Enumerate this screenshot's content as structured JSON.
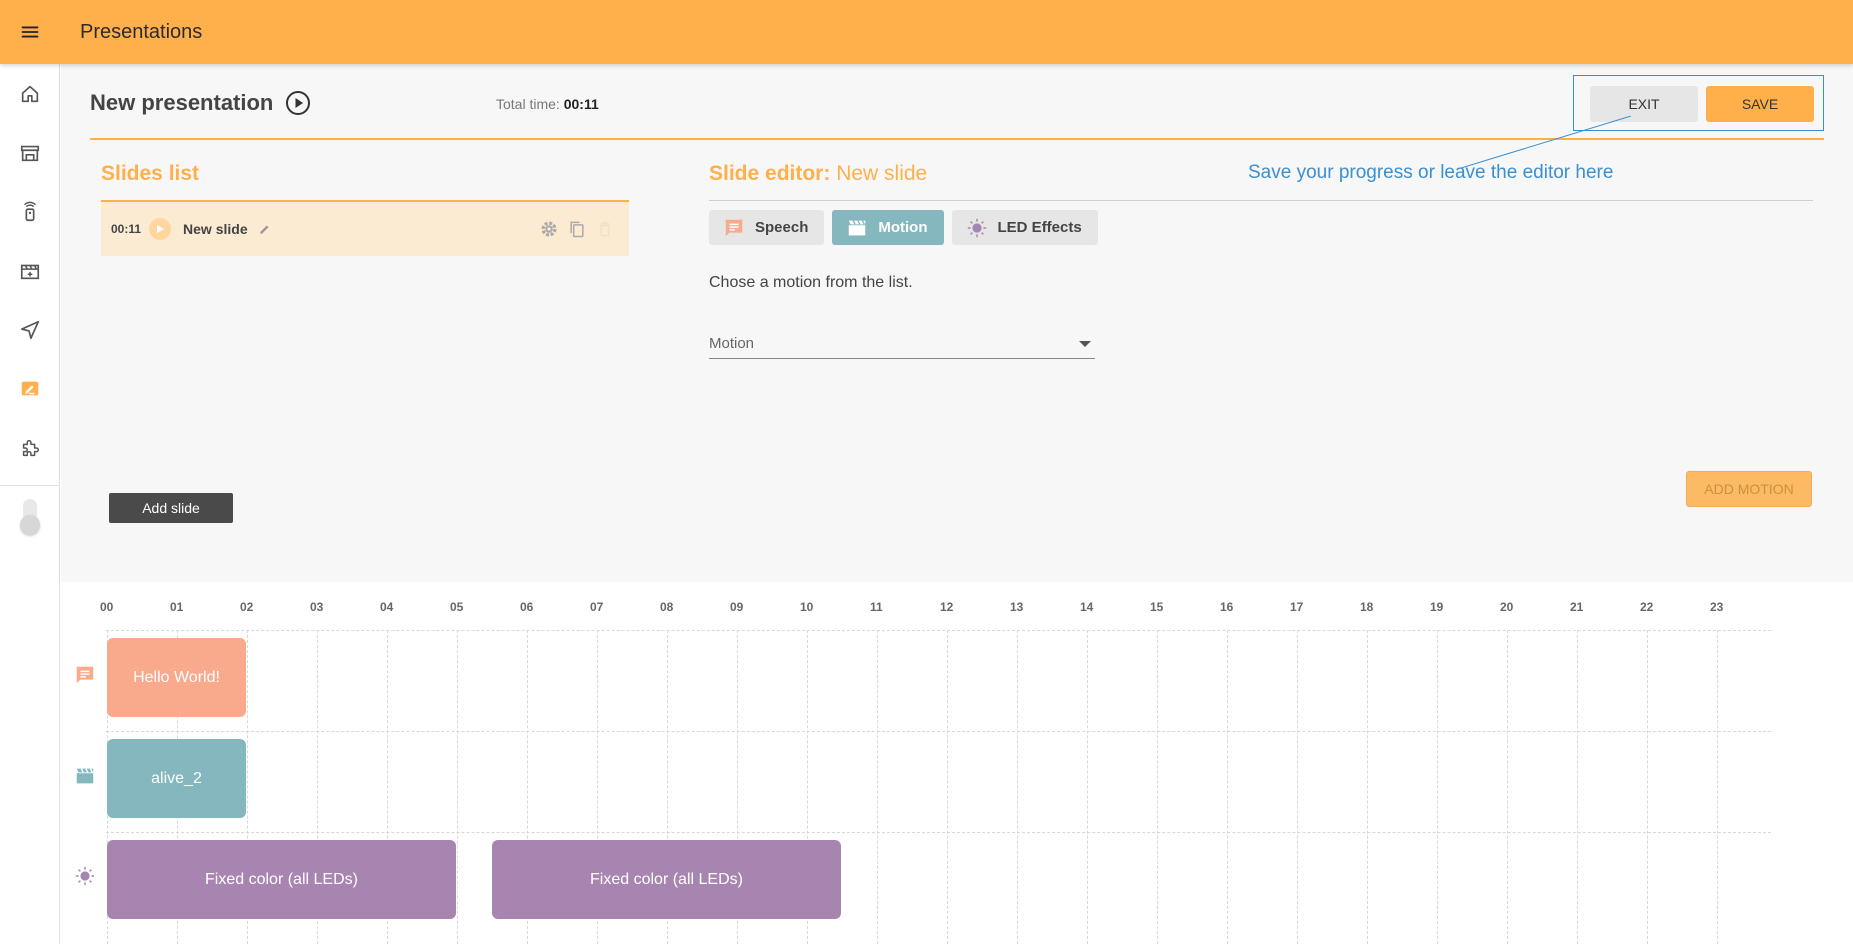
{
  "topbar": {
    "title": "Presentations"
  },
  "header": {
    "presentation_title": "New presentation",
    "total_time_label": "Total time:",
    "total_time_value": "00:11",
    "exit_label": "EXIT",
    "save_label": "SAVE",
    "callout": "Save your progress or leave the editor here"
  },
  "slides": {
    "heading": "Slides list",
    "items": [
      {
        "time": "00:11",
        "name": "New slide"
      }
    ],
    "add_label": "Add slide"
  },
  "editor": {
    "heading_label": "Slide editor:",
    "heading_name": "New slide",
    "tabs": [
      {
        "label": "Speech",
        "icon": "speech-icon"
      },
      {
        "label": "Motion",
        "icon": "motion-icon",
        "active": true
      },
      {
        "label": "LED Effects",
        "icon": "led-icon"
      }
    ],
    "instruction": "Chose a motion from the list.",
    "motion_select": {
      "value": "Motion"
    },
    "add_motion_label": "ADD MOTION"
  },
  "timeline": {
    "ticks": [
      "00",
      "01",
      "02",
      "03",
      "04",
      "05",
      "06",
      "07",
      "08",
      "09",
      "10",
      "11",
      "12",
      "13",
      "14",
      "15",
      "16",
      "17",
      "18",
      "19",
      "20",
      "21",
      "22",
      "23"
    ],
    "speech": [
      {
        "label": "Hello World!",
        "start": 0,
        "end": 2
      }
    ],
    "motion": [
      {
        "label": "alive_2",
        "start": 0,
        "end": 2
      }
    ],
    "led": [
      {
        "label": "Fixed color (all LEDs)",
        "start": 0,
        "end": 5
      },
      {
        "label": "Fixed color (all LEDs)",
        "start": 5.5,
        "end": 10.5
      }
    ]
  },
  "colors": {
    "accent": "#ffb04b",
    "speech": "#f9a98c",
    "motion": "#85b7be",
    "led": "#a884b1",
    "callout": "#3a8fd1"
  }
}
